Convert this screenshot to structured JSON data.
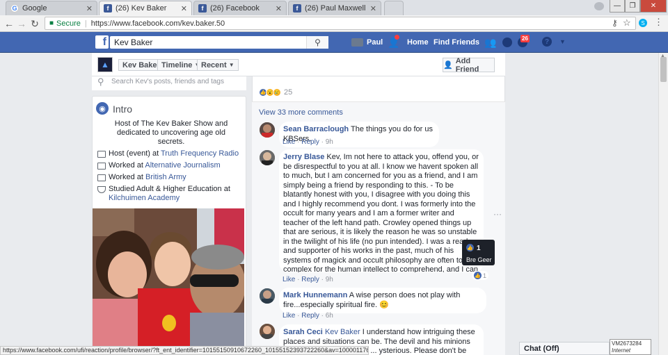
{
  "browser": {
    "tabs": [
      {
        "label": "Google",
        "favicon": "google-icon"
      },
      {
        "label": "(26) Kev Baker",
        "favicon": "facebook-icon",
        "active": true
      },
      {
        "label": "(26) Facebook",
        "favicon": "facebook-icon"
      },
      {
        "label": "(26) Paul Maxwell",
        "favicon": "facebook-icon"
      }
    ],
    "secure_label": "Secure",
    "url": "https://www.facebook.com/kev.baker.50"
  },
  "fb_header": {
    "search_value": "Kev Baker",
    "user_name": "Paul",
    "home": "Home",
    "find_friends": "Find Friends",
    "notif_count": "26",
    "brand_color": "#4267b2"
  },
  "timeline_bar": {
    "name_tab": "Kev Baker",
    "timeline_tab": "Timeline",
    "recent_tab": "Recent",
    "add_friend": "Add Friend"
  },
  "left": {
    "search_placeholder": "Search Kev's posts, friends and tags",
    "intro_title": "Intro",
    "bio": "Host of The Kev Baker Show and dedicated to uncovering age old secrets.",
    "facts": [
      {
        "prefix": "Host (event) at ",
        "link": "Truth Frequency Radio"
      },
      {
        "prefix": "Worked at ",
        "link": "Alternative Journalism"
      },
      {
        "prefix": "Worked at ",
        "link": "British Army"
      },
      {
        "prefix": "Studied Adult & Higher Education at ",
        "link": "Kilchuimen Academy"
      }
    ]
  },
  "post": {
    "reaction_count": "25",
    "view_more": "View 33 more comments",
    "comments": [
      {
        "name": "Sean Barraclough",
        "text": "The things you do for us KBSers.",
        "like": "Like",
        "reply": "Reply",
        "time": "9h"
      },
      {
        "name": "Jerry Blase",
        "text": "Kev, Im not here to attack you, offend you, or be disrespectful to you at all. I know we havent spoken all to much, but I am concerned for you as a friend, and I am simply being a friend by responding to this. - To be blatantly honest with you, I disagree with you doing this and I highly recommend you dont. I was formerly into the occult for many years and I am a former writer and teacher of the left hand path. Crowley opened things up that are serious, it is likely the reason he was so unstable in the twilight of his life (no pun intended). I was a reader and supporter of his works in the past, much of his systems of magick and occult philosophy are often to complex for the human intellect to comprehend, and I can promise you it isnt something to play with for ones own entertainment purposes or You are placing your entire being at risk by going to places like t I plead with you as a friend and human being to not go. Please t Laura's advice.",
        "like": "Like",
        "reply": "Reply",
        "time": "9h",
        "like_count": "1"
      },
      {
        "name": "Mark Hunnemann",
        "text": "A wise person does not play with fire...especially spiritual fire.",
        "like": "Like",
        "reply": "Reply",
        "time": "6h"
      },
      {
        "name": "Sarah Ceci",
        "tag": "Kev Baker",
        "text": "I understand how intriguing these places and situations can be. The devil and his minions have a way of presenting ... ysterious. Please don't be fooled. ... we should be focusing ourselves and it"
      }
    ],
    "tooltip": {
      "count": "1",
      "name": "Bre Geer"
    }
  },
  "statusbar": {
    "url": "https://www.facebook.com/ufi/reaction/profile/browser/?ft_ent_identifier=10155150910672260_10155152393722260&av=100001176633313"
  },
  "chat_label": "Chat (Off)",
  "vm": {
    "id": "VM2673284",
    "label": "Internet access"
  }
}
